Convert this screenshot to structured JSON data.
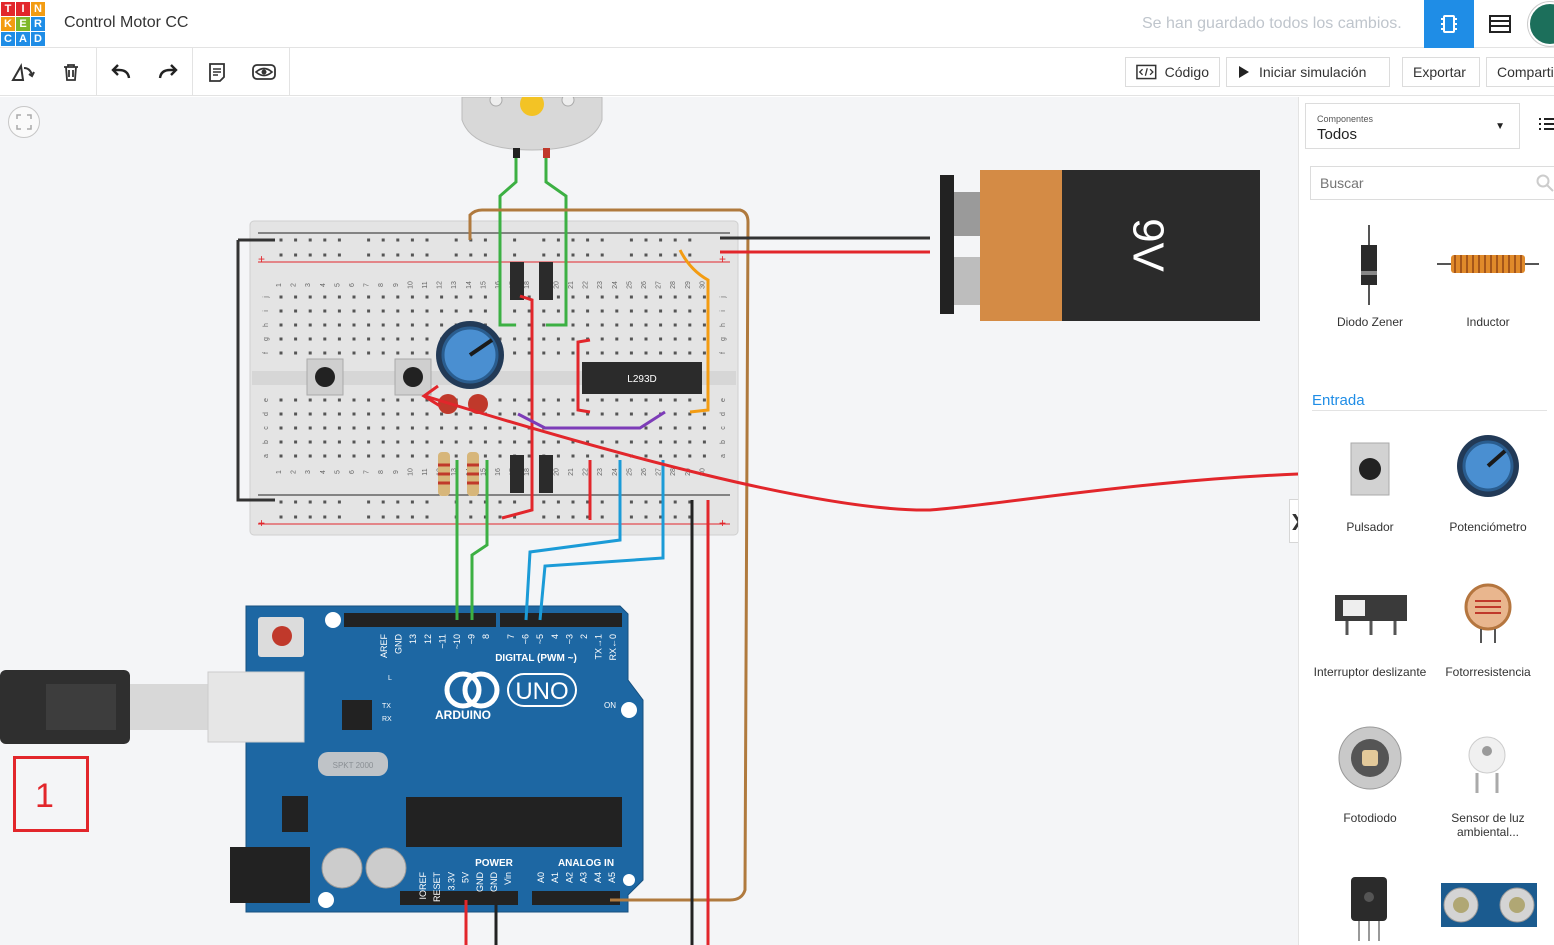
{
  "colors": {
    "accent": "#1f8de6",
    "annotation": "#e2262b"
  },
  "header": {
    "logo_letters": [
      "T",
      "I",
      "N",
      "K",
      "E",
      "R",
      "C",
      "A",
      "D"
    ],
    "project_title": "Control Motor CC",
    "save_status": "Se han guardado todos los cambios."
  },
  "toolbar": {
    "code_label": "Código",
    "simulate_label": "Iniciar simulación",
    "export_label": "Exportar",
    "share_label": "Compartir"
  },
  "circuit": {
    "battery_label": "9V",
    "ic_label": "L293D",
    "arduino_digital": "DIGITAL (PWM ~)",
    "arduino_brand": "ARDUINO",
    "arduino_model": "UNO",
    "arduino_power": "POWER",
    "arduino_analog": "ANALOG IN",
    "arduino_on": "ON",
    "arduino_l": "L",
    "arduino_tx": "TX",
    "arduino_rx": "RX",
    "digital_pins": [
      "AREF",
      "GND",
      "13",
      "12",
      "~11",
      "~10",
      "~9",
      "8",
      "7",
      "~6",
      "~5",
      "4",
      "~3",
      "2",
      "TX→1",
      "RX←0"
    ],
    "power_pins": [
      "IOREF",
      "RESET",
      "3.3V",
      "5V",
      "GND",
      "GND",
      "Vin"
    ],
    "analog_pins": [
      "A0",
      "A1",
      "A2",
      "A3",
      "A4",
      "A5"
    ],
    "breadboard_cols": [
      "1",
      "2",
      "3",
      "4",
      "5",
      "6",
      "7",
      "8",
      "9",
      "10",
      "11",
      "12",
      "13",
      "14",
      "15",
      "16",
      "17",
      "18",
      "19",
      "20",
      "21",
      "22",
      "23",
      "24",
      "25",
      "26",
      "27",
      "28",
      "29",
      "30"
    ],
    "breadboard_rows_top": [
      "j",
      "i",
      "h",
      "g",
      "f"
    ],
    "breadboard_rows_bottom": [
      "e",
      "d",
      "c",
      "b",
      "a"
    ],
    "crystal_text": "SPKT 2000"
  },
  "annotation": {
    "number": "1"
  },
  "panel": {
    "select_label": "Componentes",
    "select_value": "Todos",
    "search_placeholder": "Buscar",
    "section_input": "Entrada",
    "components": [
      {
        "label": "Diodo Zener"
      },
      {
        "label": "Inductor"
      },
      {
        "label": "Pulsador"
      },
      {
        "label": "Potenciómetro"
      },
      {
        "label": "Interruptor deslizante"
      },
      {
        "label": "Fotorresistencia"
      },
      {
        "label": "Fotodiodo"
      },
      {
        "label": "Sensor de luz ambiental..."
      }
    ]
  }
}
